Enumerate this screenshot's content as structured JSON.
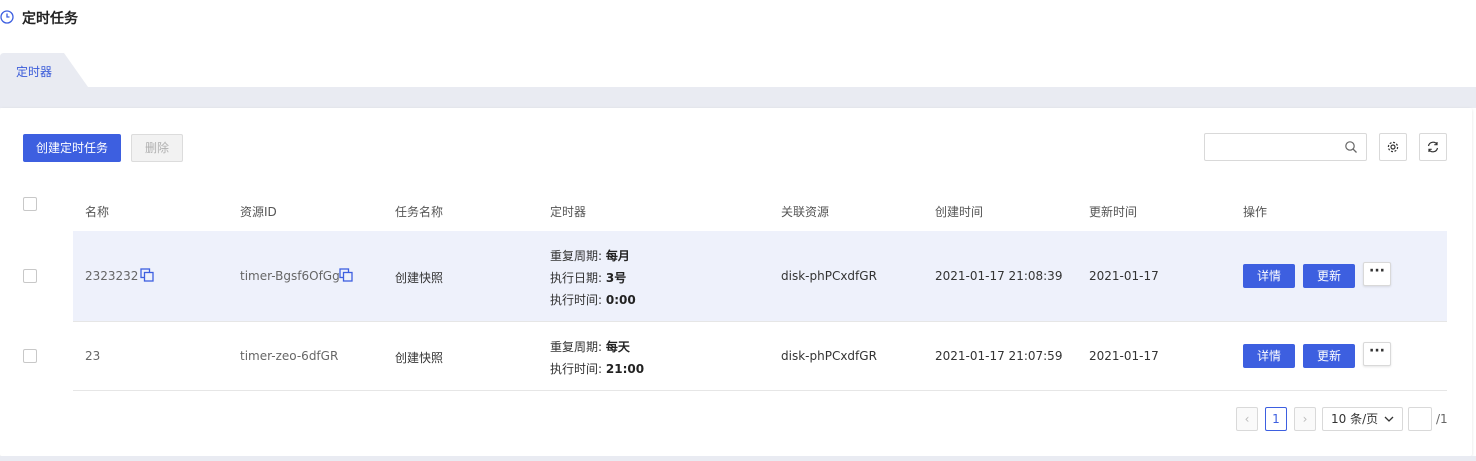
{
  "header": {
    "title": "定时任务",
    "icon": "clock-icon"
  },
  "tabs": [
    {
      "label": "定时器",
      "active": true
    }
  ],
  "toolbar": {
    "create_label": "创建定时任务",
    "delete_label": "删除",
    "search_placeholder": ""
  },
  "table": {
    "headers": {
      "name": "名称",
      "resource_id": "资源ID",
      "task_name": "任务名称",
      "timer": "定时器",
      "linked_resource": "关联资源",
      "created": "创建时间",
      "updated": "更新时间",
      "actions": "操作"
    },
    "rows": [
      {
        "name": "2323232",
        "resource_id": "timer-Bgsf6OfGg",
        "task_name": "创建快照",
        "timer": [
          {
            "label": "重复周期:",
            "value": "每月"
          },
          {
            "label": "执行日期:",
            "value": "3号"
          },
          {
            "label": "执行时间:",
            "value": "0:00"
          }
        ],
        "linked_resource": "disk-phPCxdfGR",
        "created": "2021-01-17 21:08:39",
        "updated": "2021-01-17",
        "detail_label": "详情",
        "update_label": "更新",
        "more_label": "···"
      },
      {
        "name": "23",
        "resource_id": "timer-zeo-6dfGR",
        "task_name": "创建快照",
        "timer": [
          {
            "label": "重复周期:",
            "value": "每天"
          },
          {
            "label": "执行时间:",
            "value": "21:00"
          }
        ],
        "linked_resource": "disk-phPCxdfGR",
        "created": "2021-01-17 21:07:59",
        "updated": "2021-01-17",
        "detail_label": "详情",
        "update_label": "更新",
        "more_label": "···"
      }
    ]
  },
  "pagination": {
    "prev": "‹",
    "next": "›",
    "current": "1",
    "page_size": "10 条/页",
    "page_input": "",
    "total": "/1"
  },
  "colors": {
    "primary": "#3d5fe0",
    "highlight_row": "#eef1fb",
    "strip": "#e9ebf2"
  }
}
